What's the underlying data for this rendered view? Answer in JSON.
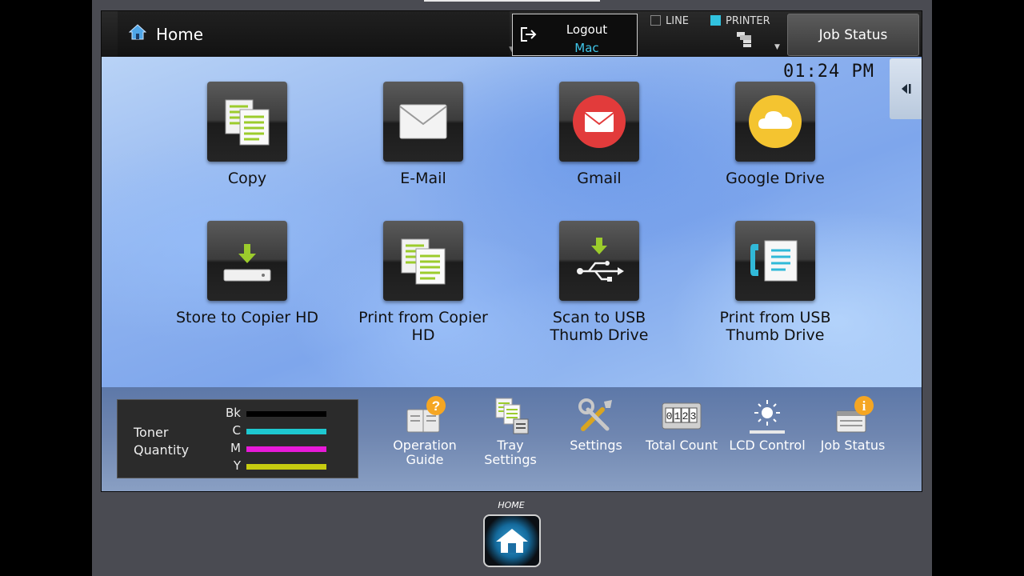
{
  "header": {
    "title": "Home",
    "logout_label": "Logout",
    "user": "Mac",
    "line_label": "LINE",
    "printer_label": "PRINTER",
    "job_status": "Job Status"
  },
  "clock": "01:24 PM",
  "apps": [
    {
      "label": "Copy",
      "icon": "copy-icon"
    },
    {
      "label": "E-Mail",
      "icon": "email-icon"
    },
    {
      "label": "Gmail",
      "icon": "gmail-icon"
    },
    {
      "label": "Google Drive",
      "icon": "google-drive-icon"
    },
    {
      "label": "Store to Copier HD",
      "icon": "store-hd-icon"
    },
    {
      "label": "Print from Copier HD",
      "icon": "print-hd-icon"
    },
    {
      "label": "Scan to USB Thumb Drive",
      "icon": "scan-usb-icon"
    },
    {
      "label": "Print from USB Thumb Drive",
      "icon": "print-usb-icon"
    }
  ],
  "toner": {
    "title": "Toner Quantity",
    "rows": [
      {
        "label": "Bk",
        "color": "#000000"
      },
      {
        "label": "C",
        "color": "#1ec8d0"
      },
      {
        "label": "M",
        "color": "#e81ad8"
      },
      {
        "label": "Y",
        "color": "#c7cc10"
      }
    ]
  },
  "utilities": [
    {
      "label": "Operation Guide",
      "icon": "operation-guide-icon"
    },
    {
      "label": "Tray Settings",
      "icon": "tray-settings-icon"
    },
    {
      "label": "Settings",
      "icon": "settings-icon"
    },
    {
      "label": "Total Count",
      "icon": "total-count-icon"
    },
    {
      "label": "LCD Control",
      "icon": "lcd-control-icon"
    },
    {
      "label": "Job Status",
      "icon": "job-status-icon"
    }
  ],
  "hardware": {
    "home_label": "HOME"
  },
  "colors": {
    "accent_cyan": "#3fc6ea",
    "tile_dark": "#2a2a2a",
    "gmail_red": "#e23b3b",
    "drive_yellow": "#f4c430"
  }
}
